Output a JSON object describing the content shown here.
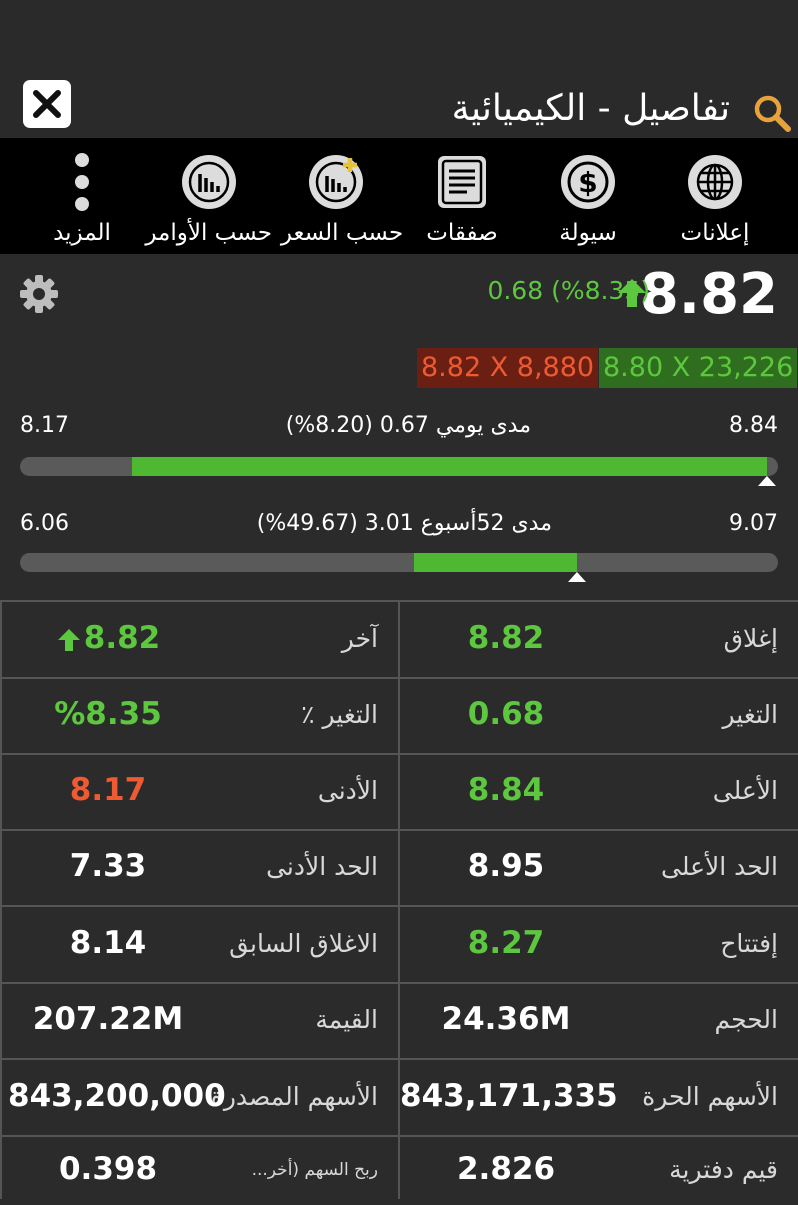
{
  "header": {
    "title": "تفاصيل - الكيميائية",
    "close_icon": "close-icon",
    "search_icon": "search-icon"
  },
  "toolbar": {
    "items": [
      {
        "label": "إعلانات",
        "icon": "globe-icon"
      },
      {
        "label": "سيولة",
        "icon": "dollar-icon"
      },
      {
        "label": "صفقات",
        "icon": "document-icon"
      },
      {
        "label": "حسب السعر",
        "icon": "chart-plus-icon"
      },
      {
        "label": "حسب الأوامر",
        "icon": "bar-chart-icon"
      },
      {
        "label": "المزيد",
        "icon": "more-vertical-icon"
      }
    ]
  },
  "quote": {
    "price": "8.82",
    "change_text": "0.68 (%8.35)",
    "direction": "up",
    "bid": "8.80 X 23,226",
    "ask": "8.82 X 8,880",
    "colors": {
      "up": "#5dc73f",
      "down": "#ee5a32"
    }
  },
  "daily_range": {
    "high": "8.84",
    "low": "8.17",
    "label": "مدى يومي 0.67 (8.20%)",
    "fill_start": 0.0,
    "fill_end": 0.985,
    "marker_position": 0.985
  },
  "week52_range": {
    "high": "9.07",
    "low": "6.06",
    "label": "مدى 52أسبوع 3.01 (49.67%)",
    "fill_start": 0.52,
    "fill_end": 0.735,
    "marker_position": 0.735
  },
  "stats": {
    "rows": [
      {
        "right_label": "إغلاق",
        "right_value": "8.82",
        "right_color": "green",
        "left_label": "آخر",
        "left_value": "8.82",
        "left_color": "green",
        "left_arrow": true
      },
      {
        "right_label": "التغير",
        "right_value": "0.68",
        "right_color": "green",
        "left_label": "التغير ٪",
        "left_value": "%8.35",
        "left_color": "green"
      },
      {
        "right_label": "الأعلى",
        "right_value": "8.84",
        "right_color": "green",
        "left_label": "الأدنى",
        "left_value": "8.17",
        "left_color": "red"
      },
      {
        "right_label": "الحد الأعلى",
        "right_value": "8.95",
        "right_color": "white",
        "left_label": "الحد الأدنى",
        "left_value": "7.33",
        "left_color": "white"
      },
      {
        "right_label": "إفتتاح",
        "right_value": "8.27",
        "right_color": "green",
        "left_label": "الاغلاق السابق",
        "left_value": "8.14",
        "left_color": "white"
      },
      {
        "right_label": "الحجم",
        "right_value": "24.36M",
        "right_color": "white",
        "left_label": "القيمة",
        "left_value": "207.22M",
        "left_color": "white"
      },
      {
        "right_label": "الأسهم الحرة",
        "right_value": "843,171,335",
        "right_color": "white",
        "left_label": "الأسهم المصدرة",
        "left_value": "843,200,000",
        "left_color": "white"
      },
      {
        "right_label": "قيم دفترية",
        "right_value": "2.826",
        "right_color": "white",
        "left_label": "ربح السهم (أخر...",
        "left_value": "0.398",
        "left_color": "white"
      }
    ]
  }
}
